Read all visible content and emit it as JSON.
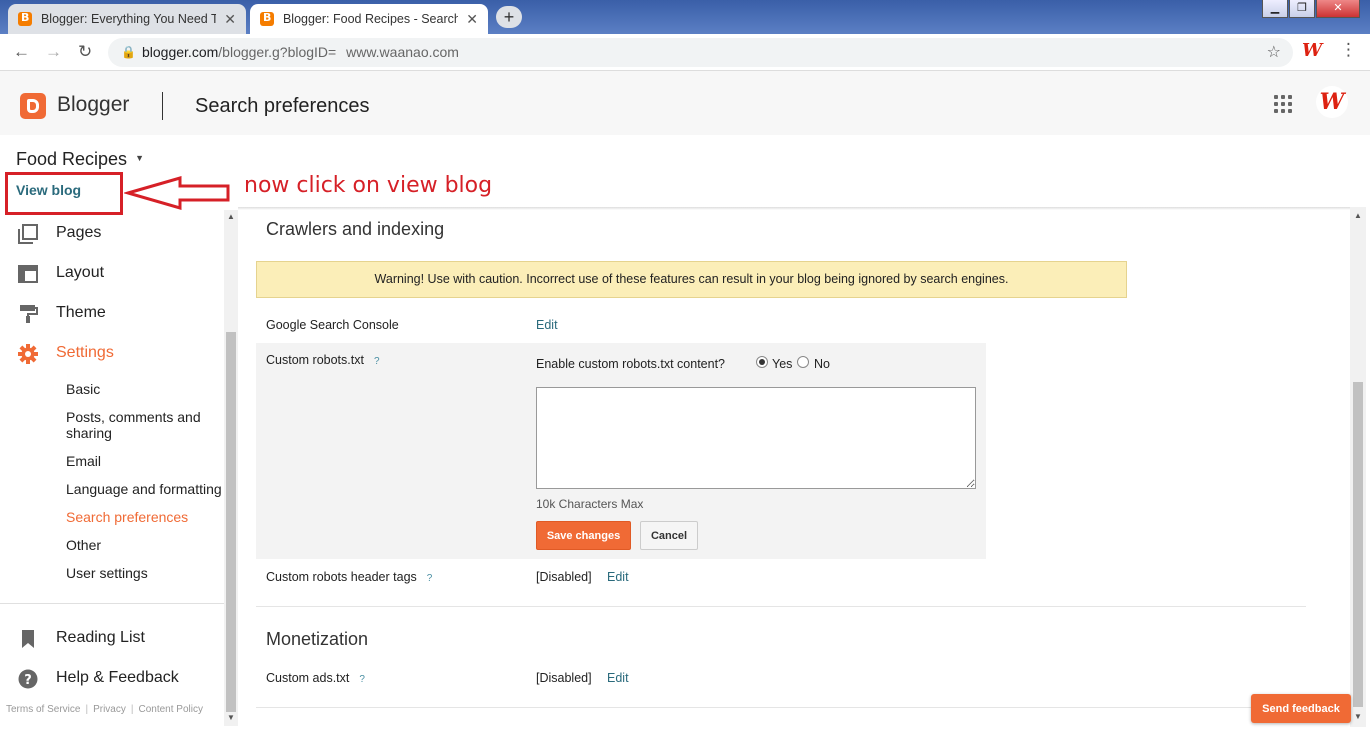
{
  "browser": {
    "tabs": [
      {
        "title": "Blogger: Everything You Need To",
        "active": false
      },
      {
        "title": "Blogger: Food Recipes - Search p",
        "active": true
      }
    ],
    "new_tab": "+",
    "window_controls": {
      "minimize": "▁",
      "maximize": "❐",
      "close": "✕"
    },
    "url_host": "blogger.com",
    "url_path": "/blogger.g?blogID=",
    "url_extra": "www.waanao.com",
    "extension_icon": "W"
  },
  "header": {
    "brand": "Blogger",
    "page_title": "Search preferences",
    "avatar_letter": "W",
    "accent_color": "#f06a35"
  },
  "blog": {
    "name": "Food Recipes",
    "view_blog": "View blog"
  },
  "annotation": {
    "text": "now click on view blog",
    "color": "#d62027"
  },
  "sidebar": {
    "items": [
      {
        "label": "Pages",
        "icon": "pages-icon"
      },
      {
        "label": "Layout",
        "icon": "layout-icon"
      },
      {
        "label": "Theme",
        "icon": "theme-icon"
      },
      {
        "label": "Settings",
        "icon": "settings-icon",
        "selected": true
      }
    ],
    "sub_items": [
      {
        "label": "Basic"
      },
      {
        "label": "Posts, comments and sharing"
      },
      {
        "label": "Email"
      },
      {
        "label": "Language and formatting"
      },
      {
        "label": "Search preferences",
        "selected": true
      },
      {
        "label": "Other"
      },
      {
        "label": "User settings"
      }
    ],
    "bottom_items": [
      {
        "label": "Reading List",
        "icon": "bookmark-icon"
      },
      {
        "label": "Help & Feedback",
        "icon": "help-icon"
      }
    ],
    "footer_links": [
      "Terms of Service",
      "Privacy",
      "Content Policy"
    ]
  },
  "main": {
    "crawlers_title": "Crawlers and indexing",
    "warning": "Warning! Use with caution. Incorrect use of these features can result in your blog being ignored by search engines.",
    "rows": {
      "search_console": {
        "label": "Google Search Console",
        "action": "Edit"
      },
      "custom_robots": {
        "label": "Custom robots.txt",
        "help": "?"
      },
      "robots_header": {
        "label": "Custom robots header tags",
        "help": "?",
        "status": "[Disabled]",
        "action": "Edit"
      }
    },
    "robots_editor": {
      "question": "Enable custom robots.txt content?",
      "yes_label": "Yes",
      "no_label": "No",
      "selected": "Yes",
      "textarea_value": "",
      "max_note": "10k Characters Max",
      "save_label": "Save changes",
      "cancel_label": "Cancel"
    },
    "monetization_title": "Monetization",
    "ads_row": {
      "label": "Custom ads.txt",
      "help": "?",
      "status": "[Disabled]",
      "action": "Edit"
    }
  },
  "feedback_button": "Send feedback"
}
